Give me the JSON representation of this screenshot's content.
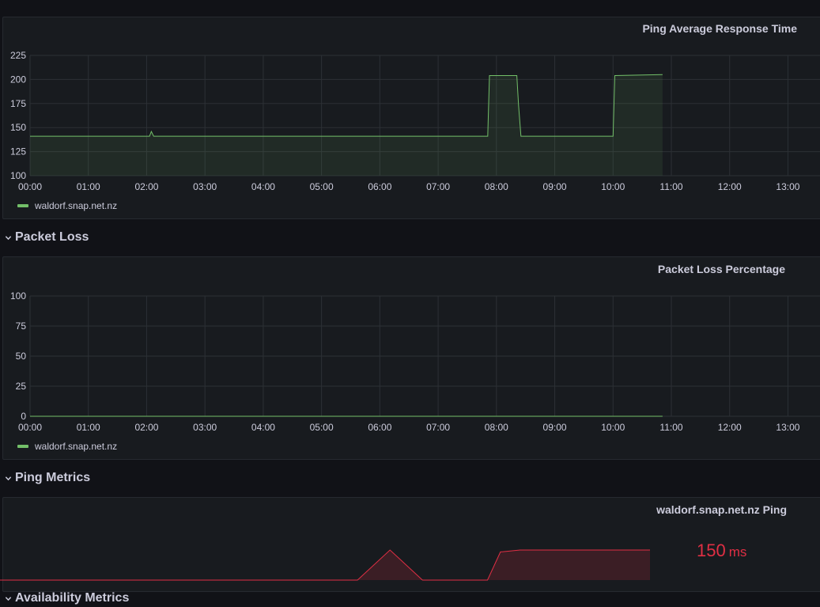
{
  "colors": {
    "series_green": "#73bf69",
    "series_red": "#e02f44",
    "grid": "#2c3035",
    "axis_text": "#ccccdc"
  },
  "panel_response": {
    "title": "Ping Average Response Time",
    "legend": "waldorf.snap.net.nz",
    "chart_data": {
      "type": "area",
      "x_ticks": [
        "00:00",
        "01:00",
        "02:00",
        "03:00",
        "04:00",
        "05:00",
        "06:00",
        "07:00",
        "08:00",
        "09:00",
        "10:00",
        "11:00",
        "12:00",
        "13:00"
      ],
      "y_ticks": [
        100,
        125,
        150,
        175,
        200,
        225
      ],
      "ylim": [
        100,
        225
      ],
      "xlim_hours": [
        0,
        13.55
      ],
      "grid": true,
      "legend_position": "bottom-left",
      "series": [
        {
          "name": "waldorf.snap.net.nz",
          "x": [
            0,
            2.05,
            2.08,
            2.12,
            7.85,
            7.88,
            8.35,
            8.38,
            8.42,
            10.0,
            10.03,
            10.85
          ],
          "y": [
            141,
            141,
            146,
            141,
            141,
            204,
            204,
            173,
            141,
            141,
            204,
            205
          ]
        }
      ]
    }
  },
  "row_packet_loss": {
    "label": "Packet Loss",
    "icon": "chevron-down-icon"
  },
  "panel_loss": {
    "title": "Packet Loss Percentage",
    "legend": "waldorf.snap.net.nz",
    "chart_data": {
      "type": "area",
      "x_ticks": [
        "00:00",
        "01:00",
        "02:00",
        "03:00",
        "04:00",
        "05:00",
        "06:00",
        "07:00",
        "08:00",
        "09:00",
        "10:00",
        "11:00",
        "12:00",
        "13:00"
      ],
      "y_ticks": [
        0,
        25,
        50,
        75,
        100
      ],
      "ylim": [
        0,
        100
      ],
      "xlim_hours": [
        0,
        13.55
      ],
      "grid": true,
      "legend_position": "bottom-left",
      "series": [
        {
          "name": "waldorf.snap.net.nz",
          "x": [
            0,
            10.85
          ],
          "y": [
            0,
            0
          ]
        }
      ]
    }
  },
  "row_ping_metrics": {
    "label": "Ping Metrics",
    "icon": "chevron-down-icon"
  },
  "panel_stat": {
    "title": "waldorf.snap.net.nz Ping",
    "value": "150",
    "unit": "ms",
    "sparkline": {
      "x": [
        0,
        0.55,
        0.6,
        0.65,
        0.7,
        0.75,
        0.77,
        0.8,
        1.0
      ],
      "y": [
        141,
        141,
        204,
        141,
        141,
        141,
        200,
        204,
        204
      ]
    }
  },
  "row_availability": {
    "label": "Availability Metrics",
    "icon": "chevron-down-icon"
  }
}
